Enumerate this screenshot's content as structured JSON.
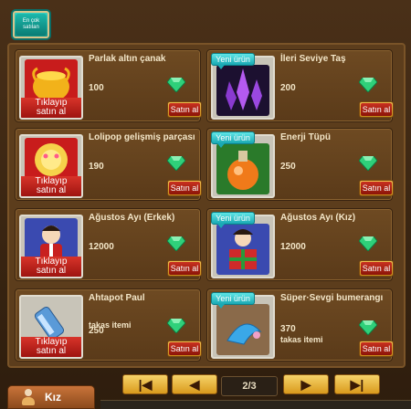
{
  "tab": {
    "label": "En çok\nsatılan"
  },
  "buy_overlay": "Tıklayıp\nsatın al",
  "new_badge": "Yeni ürün",
  "buy_button": "Satın al",
  "items": [
    {
      "name": "Parlak altın çanak",
      "price": "100",
      "sub": "",
      "art": "golden-bowl"
    },
    {
      "name": "İleri Seviye Taş",
      "price": "200",
      "sub": "",
      "art": "purple-crystal"
    },
    {
      "name": "Lolipop gelişmiş parçası",
      "price": "190",
      "sub": "",
      "art": "lollipop-part"
    },
    {
      "name": "Enerji Tüpü",
      "price": "250",
      "sub": "",
      "art": "energy-flask"
    },
    {
      "name": "Ağustos Ayı (Erkek)",
      "price": "12000",
      "sub": "",
      "art": "august-bear-male"
    },
    {
      "name": "Ağustos Ayı (Kız)",
      "price": "12000",
      "sub": "",
      "art": "august-bear-female"
    },
    {
      "name": "Ahtapot Paul",
      "price": "250",
      "sub": "takas itemi",
      "art": "octopus-tube"
    },
    {
      "name": "Süper·Sevgi bumerangı",
      "price": "370",
      "sub": "takas itemi",
      "art": "love-boomerang"
    }
  ],
  "pager": {
    "first": "|◀",
    "prev": "◀",
    "page": "2/3",
    "next": "▶",
    "last": "▶|"
  },
  "bottom_tab": {
    "label": "Kız"
  },
  "colors": {
    "gem": "#2fd07a",
    "new_badge": "#1aa9b4",
    "buy_button": "#c83020"
  }
}
